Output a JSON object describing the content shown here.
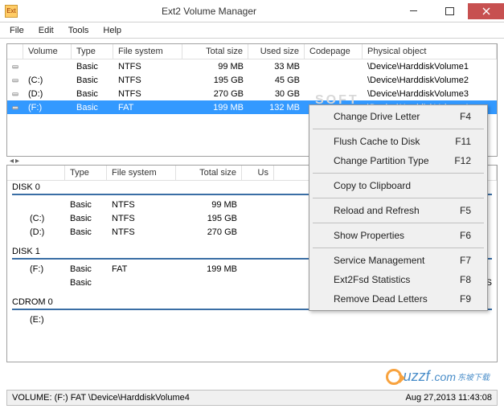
{
  "window": {
    "title": "Ext2 Volume Manager",
    "app_icon_text": "Ext"
  },
  "menubar": {
    "items": [
      "File",
      "Edit",
      "Tools",
      "Help"
    ]
  },
  "upper_grid": {
    "headers": [
      "Volume",
      "Type",
      "File system",
      "Total size",
      "Used size",
      "Codepage",
      "Physical object"
    ],
    "rows": [
      {
        "volume": "",
        "type": "Basic",
        "fs": "NTFS",
        "total": "99 MB",
        "used": "33 MB",
        "codepage": "",
        "phys": "\\Device\\HarddiskVolume1",
        "selected": false
      },
      {
        "volume": "(C:)",
        "type": "Basic",
        "fs": "NTFS",
        "total": "195 GB",
        "used": "45 GB",
        "codepage": "",
        "phys": "\\Device\\HarddiskVolume2",
        "selected": false
      },
      {
        "volume": "(D:)",
        "type": "Basic",
        "fs": "NTFS",
        "total": "270 GB",
        "used": "30 GB",
        "codepage": "",
        "phys": "\\Device\\HarddiskVolume3",
        "selected": false
      },
      {
        "volume": "(F:)",
        "type": "Basic",
        "fs": "FAT",
        "total": "199 MB",
        "used": "132 MB",
        "codepage": "",
        "phys": "\\Device\\HarddiskVolume4",
        "selected": true
      }
    ]
  },
  "lower_grid": {
    "headers": [
      "",
      "Type",
      "File system",
      "Total size",
      "Us",
      ""
    ],
    "groups": [
      {
        "label": "DISK 0",
        "rows": [
          {
            "indent": "",
            "type": "Basic",
            "fs": "NTFS",
            "total": "99 MB",
            "rest": ""
          },
          {
            "indent": "(C:)",
            "type": "Basic",
            "fs": "NTFS",
            "total": "195 GB",
            "rest": ""
          },
          {
            "indent": "(D:)",
            "type": "Basic",
            "fs": "NTFS",
            "total": "270 GB",
            "rest": ""
          }
        ]
      },
      {
        "label": "DISK 1",
        "rows": [
          {
            "indent": "(F:)",
            "type": "Basic",
            "fs": "FAT",
            "total": "199 MB",
            "rest": ""
          },
          {
            "indent": "",
            "type": "Basic",
            "fs": "",
            "total": "",
            "rest": "HPFS/NTFS"
          }
        ]
      },
      {
        "label": "CDROM 0",
        "rows": [
          {
            "indent": "(E:)",
            "type": "",
            "fs": "",
            "total": "",
            "rest": ""
          }
        ]
      }
    ]
  },
  "context_menu": {
    "groups": [
      [
        {
          "label": "Change Drive Letter",
          "accel": "F4"
        }
      ],
      [
        {
          "label": "Flush Cache to Disk",
          "accel": "F11"
        },
        {
          "label": "Change Partition Type",
          "accel": "F12"
        }
      ],
      [
        {
          "label": "Copy to Clipboard",
          "accel": ""
        }
      ],
      [
        {
          "label": "Reload and Refresh",
          "accel": "F5"
        }
      ],
      [
        {
          "label": "Show Properties",
          "accel": "F6"
        }
      ],
      [
        {
          "label": "Service Management",
          "accel": "F7"
        },
        {
          "label": "Ext2Fsd Statistics",
          "accel": "F8"
        },
        {
          "label": "Remove Dead Letters",
          "accel": "F9"
        }
      ]
    ]
  },
  "statusbar": {
    "left": "VOLUME: (F:) FAT \\Device\\HarddiskVolume4",
    "right": "Aug 27,2013 11:43:08"
  },
  "watermark": {
    "text": "uzzf",
    "suffix": ".com",
    "cn": "东坡下载"
  },
  "soft_watermark": "SOFT"
}
